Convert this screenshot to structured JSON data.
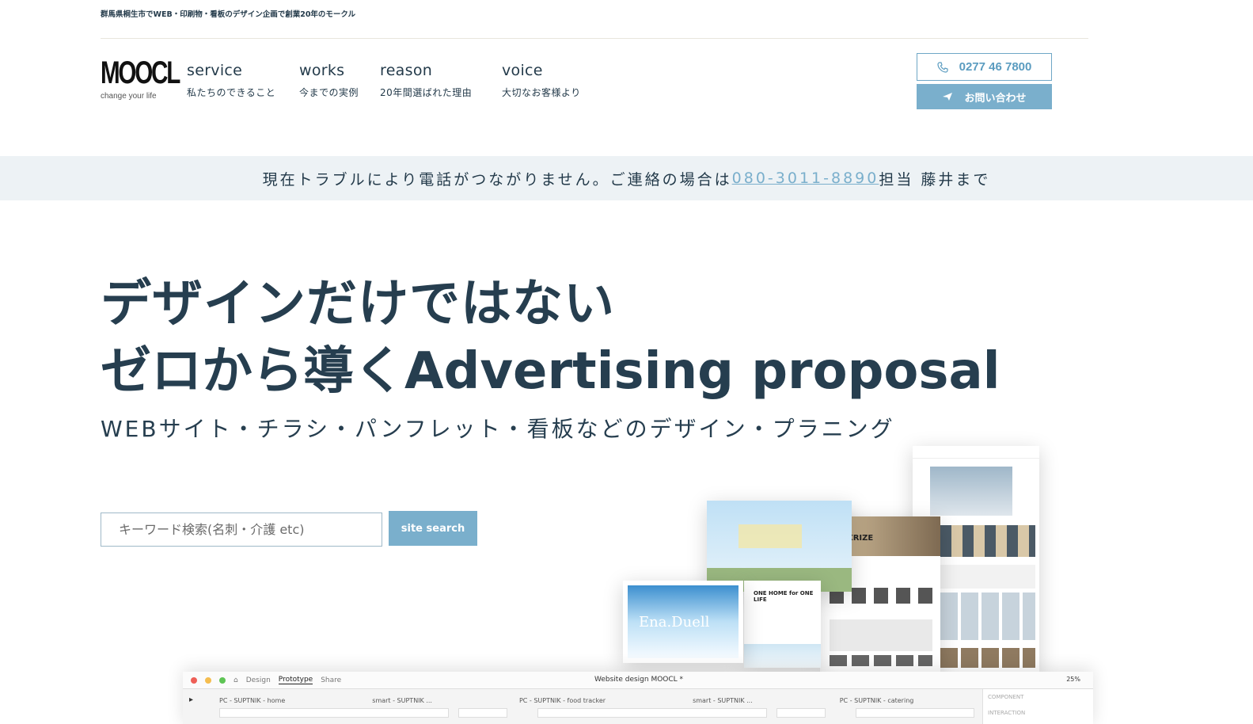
{
  "header": {
    "tagline": "群馬県桐生市でWEB・印刷物・看板のデザイン企画で創業20年のモークル",
    "logo_text": "MOOCL",
    "logo_sub": "change your life",
    "nav": [
      {
        "en": "service",
        "jp": "私たちのできること"
      },
      {
        "en": "works",
        "jp": "今までの実例"
      },
      {
        "en": "reason",
        "jp": "20年間選ばれた理由"
      },
      {
        "en": "voice",
        "jp": "大切なお客様より"
      }
    ],
    "phone_label": "0277 46 7800",
    "contact_label": "お問い合わせ"
  },
  "notice": {
    "text_before": "現在トラブルにより電話がつながりません。ご連絡の場合は",
    "phone": "080-3011-8890",
    "text_after": " 担当 藤井まで"
  },
  "hero": {
    "line1": "デザインだけではない",
    "line2": "ゼロから導くAdvertising proposal",
    "sub": "WEBサイト・チラシ・パンフレット・看板などのデザイン・プラニング"
  },
  "search": {
    "placeholder": "キーワード検索(名刺・介護 etc)",
    "button_label": "site search"
  },
  "figma": {
    "tabs": [
      "Design",
      "Prototype",
      "Share"
    ],
    "title": "Website design MOOCL *",
    "zoom": "25%",
    "frames": [
      "PC - SUPTNIK - home",
      "smart - SUPTNIK ...",
      "PC - SUPTNIK - food tracker",
      "smart - SUPTNIK ...",
      "PC - SUPTNIK - catering"
    ],
    "panel_label": "COMPONENT",
    "panel_label2": "INTERACTION"
  },
  "collage": {
    "c4_text": "Ena.Duell",
    "c2_text": "XRIZE",
    "c5_text": "ONE HOME for ONE LIFE"
  },
  "colors": {
    "accent": "#7aafcc",
    "text": "#263e4f",
    "notice_bg": "#edf2f5"
  }
}
